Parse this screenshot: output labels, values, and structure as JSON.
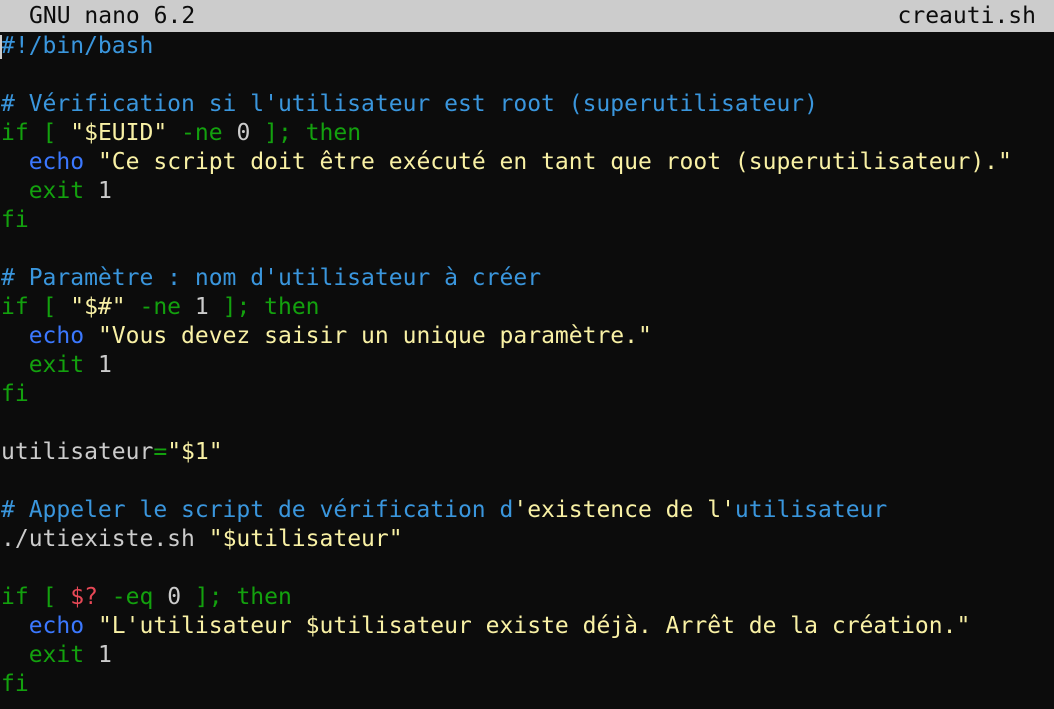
{
  "titlebar": {
    "app": "GNU nano 6.2",
    "filename": "creauti.sh"
  },
  "colors": {
    "background": "#0c0c0c",
    "text": "#cccccc",
    "titlebar_bg": "#cccccc",
    "titlebar_fg": "#0c0c0c",
    "comment": "#3a96dd",
    "keyword": "#13a10e",
    "string": "#f9f1a5",
    "builtin": "#3b78ff",
    "variable": "#e74856"
  },
  "lines": [
    [
      {
        "t": "#!/bin/bash",
        "c": "comment"
      }
    ],
    [],
    [
      {
        "t": "# Vérification si l'utilisateur est root (superutilisateur)",
        "c": "comment"
      }
    ],
    [
      {
        "t": "if [ ",
        "c": "keyword"
      },
      {
        "t": "\"$EUID\"",
        "c": "string"
      },
      {
        "t": " -ne ",
        "c": "keyword"
      },
      {
        "t": "0",
        "c": "text"
      },
      {
        "t": " ]; then",
        "c": "keyword"
      }
    ],
    [
      {
        "t": "  ",
        "c": "text"
      },
      {
        "t": "echo",
        "c": "builtin"
      },
      {
        "t": " ",
        "c": "text"
      },
      {
        "t": "\"Ce script doit être exécuté en tant que root (superutilisateur).\"",
        "c": "string"
      }
    ],
    [
      {
        "t": "  ",
        "c": "text"
      },
      {
        "t": "exit",
        "c": "keyword"
      },
      {
        "t": " 1",
        "c": "text"
      }
    ],
    [
      {
        "t": "fi",
        "c": "keyword"
      }
    ],
    [],
    [
      {
        "t": "# Paramètre : nom d'utilisateur à créer",
        "c": "comment"
      }
    ],
    [
      {
        "t": "if [ ",
        "c": "keyword"
      },
      {
        "t": "\"$#\"",
        "c": "string"
      },
      {
        "t": " -ne ",
        "c": "keyword"
      },
      {
        "t": "1",
        "c": "text"
      },
      {
        "t": " ]; then",
        "c": "keyword"
      }
    ],
    [
      {
        "t": "  ",
        "c": "text"
      },
      {
        "t": "echo",
        "c": "builtin"
      },
      {
        "t": " ",
        "c": "text"
      },
      {
        "t": "\"Vous devez saisir un unique paramètre.\"",
        "c": "string"
      }
    ],
    [
      {
        "t": "  ",
        "c": "text"
      },
      {
        "t": "exit",
        "c": "keyword"
      },
      {
        "t": " 1",
        "c": "text"
      }
    ],
    [
      {
        "t": "fi",
        "c": "keyword"
      }
    ],
    [],
    [
      {
        "t": "utilisateur",
        "c": "text"
      },
      {
        "t": "=",
        "c": "keyword"
      },
      {
        "t": "\"$1\"",
        "c": "string"
      }
    ],
    [],
    [
      {
        "t": "# Appeler le script de vérification d",
        "c": "comment"
      },
      {
        "t": "'existence de l'",
        "c": "string"
      },
      {
        "t": "utilisateur",
        "c": "comment"
      }
    ],
    [
      {
        "t": "./utiexiste.sh ",
        "c": "text"
      },
      {
        "t": "\"$utilisateur\"",
        "c": "string"
      }
    ],
    [],
    [
      {
        "t": "if [ ",
        "c": "keyword"
      },
      {
        "t": "$?",
        "c": "variable"
      },
      {
        "t": " -eq ",
        "c": "keyword"
      },
      {
        "t": "0",
        "c": "text"
      },
      {
        "t": " ]; then",
        "c": "keyword"
      }
    ],
    [
      {
        "t": "  ",
        "c": "text"
      },
      {
        "t": "echo",
        "c": "builtin"
      },
      {
        "t": " ",
        "c": "text"
      },
      {
        "t": "\"L'utilisateur $utilisateur existe déjà. Arrêt de la création.\"",
        "c": "string"
      }
    ],
    [
      {
        "t": "  ",
        "c": "text"
      },
      {
        "t": "exit",
        "c": "keyword"
      },
      {
        "t": " 1",
        "c": "text"
      }
    ],
    [
      {
        "t": "fi",
        "c": "keyword"
      }
    ]
  ]
}
